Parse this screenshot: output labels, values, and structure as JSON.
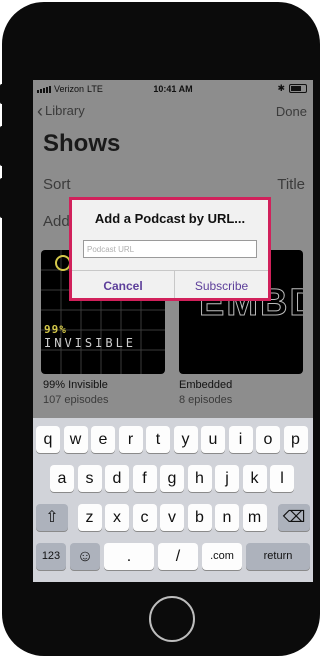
{
  "status_bar": {
    "carrier": "Verizon",
    "network": "LTE",
    "time": "10:41 AM"
  },
  "nav": {
    "back_label": "Library",
    "done_label": "Done"
  },
  "page": {
    "title": "Shows",
    "sort_label": "Sort",
    "sort_value": "Title",
    "add_label": "Add"
  },
  "shows": [
    {
      "name": "99% Invisible",
      "episodes": "107 episodes",
      "art_top": "99%",
      "art_text": "INVISIBLE"
    },
    {
      "name": "Embedded",
      "episodes": "8 episodes",
      "art_text": "EMBD"
    }
  ],
  "dialog": {
    "title": "Add a Podcast by URL...",
    "placeholder": "Podcast URL",
    "value": "",
    "cancel_label": "Cancel",
    "subscribe_label": "Subscribe",
    "accent_color": "#d1215b",
    "button_color": "#5d3f9a"
  },
  "keyboard": {
    "row1": [
      "q",
      "w",
      "e",
      "r",
      "t",
      "y",
      "u",
      "i",
      "o",
      "p"
    ],
    "row2": [
      "a",
      "s",
      "d",
      "f",
      "g",
      "h",
      "j",
      "k",
      "l"
    ],
    "row3": [
      "z",
      "x",
      "c",
      "v",
      "b",
      "n",
      "m"
    ],
    "numbers_label": "123",
    "dot_label": ".",
    "slash_label": "/",
    "dotcom_label": ".com",
    "return_label": "return"
  }
}
